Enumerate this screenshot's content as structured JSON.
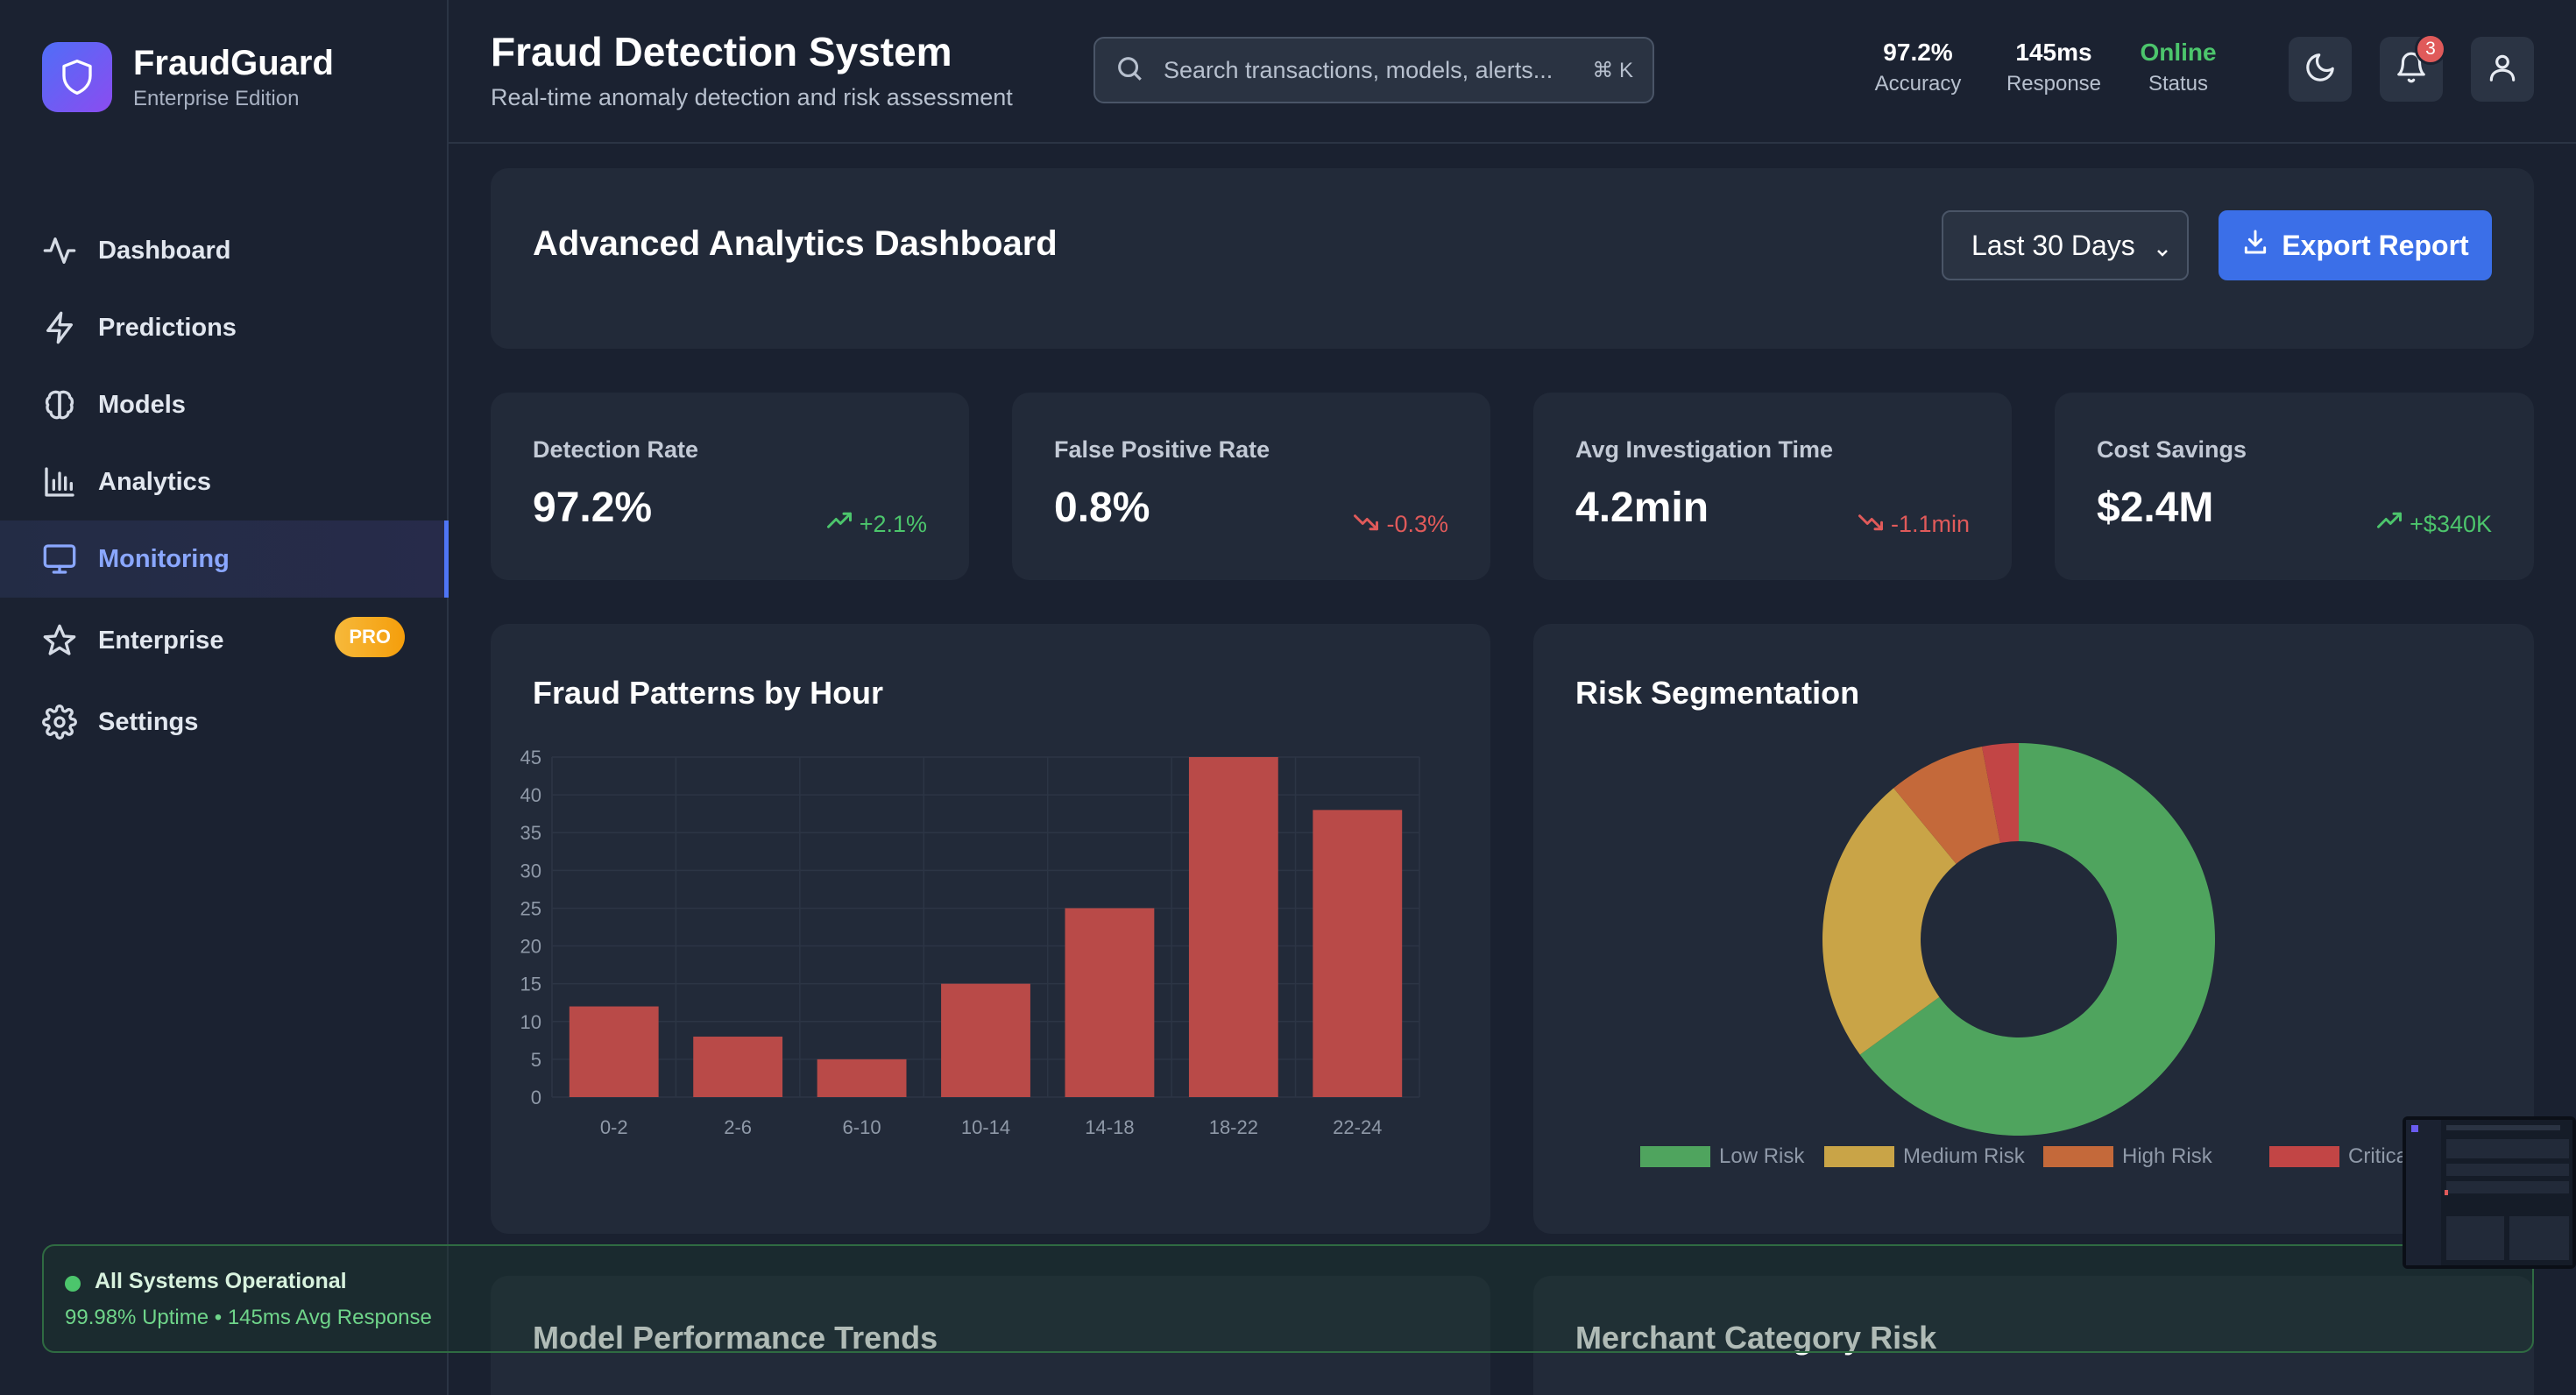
{
  "brand": {
    "name": "FraudGuard",
    "edition": "Enterprise Edition",
    "gradient": [
      "#4f6ef7",
      "#8b4cf0"
    ]
  },
  "sidebar": {
    "items": [
      {
        "label": "Dashboard",
        "icon": "activity-icon"
      },
      {
        "label": "Predictions",
        "icon": "zap-icon"
      },
      {
        "label": "Models",
        "icon": "brain-icon"
      },
      {
        "label": "Analytics",
        "icon": "bar-chart-icon"
      },
      {
        "label": "Monitoring",
        "icon": "monitor-icon",
        "active": true
      },
      {
        "label": "Enterprise",
        "icon": "star-icon",
        "badge": "PRO"
      },
      {
        "label": "Settings",
        "icon": "gear-icon"
      }
    ]
  },
  "header": {
    "title": "Fraud Detection System",
    "subtitle": "Real-time anomaly detection and risk assessment",
    "search": {
      "placeholder": "Search transactions, models, alerts...",
      "shortcut": "⌘ K"
    },
    "stats": [
      {
        "value": "97.2%",
        "label": "Accuracy"
      },
      {
        "value": "145ms",
        "label": "Response"
      },
      {
        "value": "Online",
        "label": "Status"
      }
    ],
    "notification_count": "3"
  },
  "dashboard": {
    "title": "Advanced Analytics Dashboard",
    "range": "Last 30 Days",
    "export_label": "Export Report"
  },
  "kpis": [
    {
      "label": "Detection Rate",
      "value": "97.2%",
      "change": "+2.1%",
      "trend": "up"
    },
    {
      "label": "False Positive Rate",
      "value": "0.8%",
      "change": "-0.3%",
      "trend": "down"
    },
    {
      "label": "Avg Investigation Time",
      "value": "4.2min",
      "change": "-1.1min",
      "trend": "down"
    },
    {
      "label": "Cost Savings",
      "value": "$2.4M",
      "change": "+$340K",
      "trend": "up"
    }
  ],
  "chart_data": [
    {
      "type": "bar",
      "title": "Fraud Patterns by Hour",
      "categories": [
        "0-2",
        "2-6",
        "6-10",
        "10-14",
        "14-18",
        "18-22",
        "22-24"
      ],
      "values": [
        12,
        8,
        5,
        15,
        25,
        45,
        38
      ],
      "ylim": [
        0,
        45
      ],
      "yticks": [
        0,
        5,
        10,
        15,
        20,
        25,
        30,
        35,
        40,
        45
      ],
      "grid": true,
      "color": "#b94a48"
    },
    {
      "type": "pie",
      "title": "Risk Segmentation",
      "donut": true,
      "categories": [
        "Low Risk",
        "Medium Risk",
        "High Risk",
        "Critical Risk"
      ],
      "values": [
        65,
        24,
        8,
        3
      ],
      "colors": [
        "#4fa45e",
        "#c9a447",
        "#c4693a",
        "#c24545"
      ],
      "legend": "bottom"
    }
  ],
  "lower_cards": {
    "left_title": "Model Performance Trends",
    "right_title": "Merchant Category Risk"
  },
  "status": {
    "title": "All Systems Operational",
    "detail": "99.98% Uptime • 145ms Avg Response"
  },
  "colors": {
    "accent": "#3b6fe8",
    "success": "#4cc56c",
    "danger": "#e05a5a"
  }
}
